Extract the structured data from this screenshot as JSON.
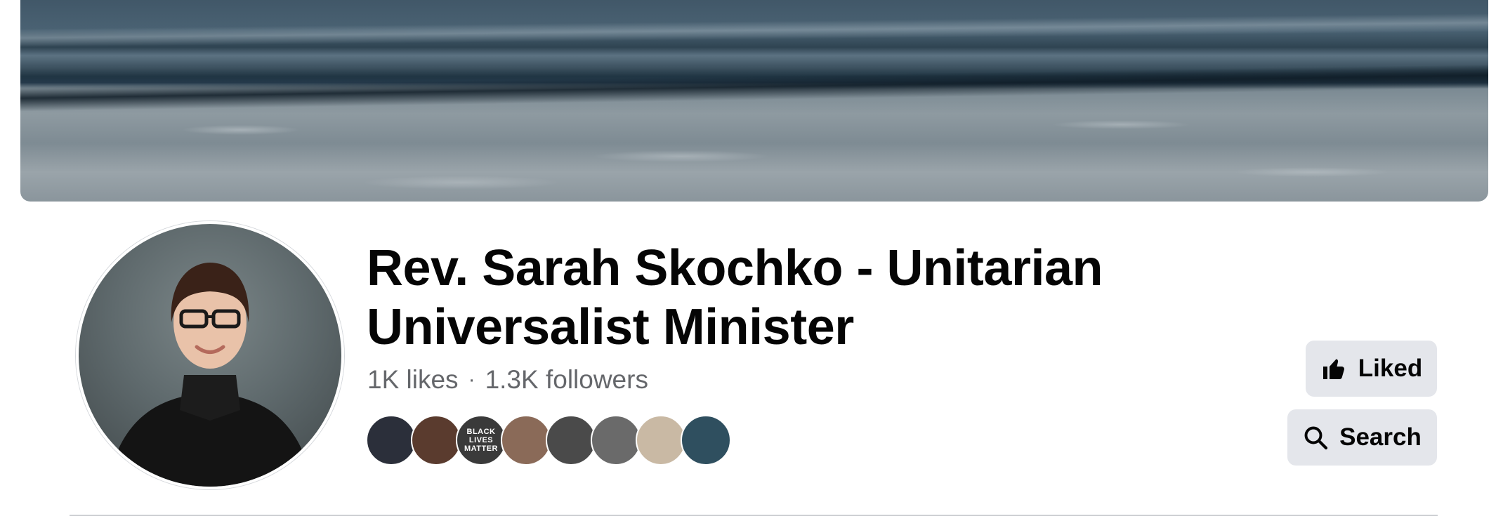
{
  "page": {
    "name": "Rev. Sarah Skochko - Unitarian Universalist Minister",
    "likes": "1K likes",
    "separator": "·",
    "followers": "1.3K followers"
  },
  "actions": {
    "liked_label": "Liked",
    "search_label": "Search"
  },
  "friends": [
    {
      "name": "friend-avatar-1",
      "color": "#2b2f3a"
    },
    {
      "name": "friend-avatar-2",
      "color": "#5a3b2e"
    },
    {
      "name": "friend-avatar-3",
      "color": "#3a3a3a",
      "text": "BLACK LIVES MATTER"
    },
    {
      "name": "friend-avatar-4",
      "color": "#8a6a58"
    },
    {
      "name": "friend-avatar-5",
      "color": "#4a4a4a"
    },
    {
      "name": "friend-avatar-6",
      "color": "#6a6a6a"
    },
    {
      "name": "friend-avatar-7",
      "color": "#c9b9a4"
    },
    {
      "name": "friend-avatar-8",
      "color": "#2f4f5f"
    }
  ],
  "colors": {
    "button_bg": "#e4e6eb",
    "text_primary": "#050505",
    "text_secondary": "#65676b"
  },
  "icons": {
    "liked": "thumbs-up-icon",
    "search": "search-icon"
  }
}
